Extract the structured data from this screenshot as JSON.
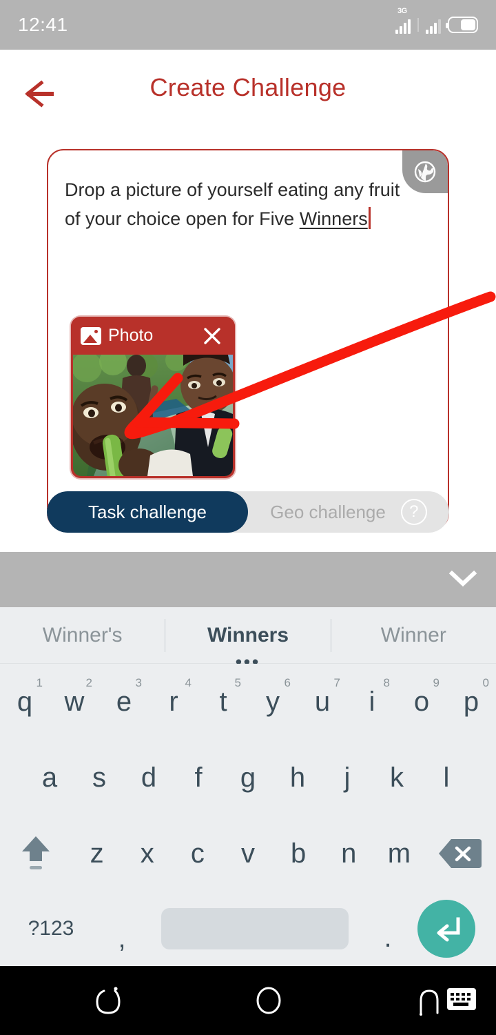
{
  "status_bar": {
    "time": "12:41",
    "network_label": "3G",
    "signal_icon": "signal-bars-icon",
    "battery_icon": "battery-icon",
    "battery_level_pct": 58,
    "background": "#b4b4b4"
  },
  "header": {
    "back_icon": "back-arrow-icon",
    "title": "Create Challenge",
    "title_color": "#b8312a"
  },
  "card": {
    "border_color": "#b8312a",
    "globe_icon": "globe-icon",
    "text_before": "Drop a picture of yourself eating any fruit of your choice open for Five ",
    "text_underlined": "Winners",
    "caret_color": "#b8312a",
    "attachment": {
      "icon": "image-icon",
      "label": "Photo",
      "close_icon": "close-icon",
      "header_color": "#b8312a"
    }
  },
  "segment_toggle": {
    "active_label": "Task challenge",
    "active_color": "#103a5d",
    "inactive_label": "Geo challenge",
    "inactive_color": "#e4e4e4",
    "help_icon": "help-question-icon",
    "help_label": "?"
  },
  "annotation": {
    "arrow_icon": "red-annotation-arrow",
    "color": "#f71b0d"
  },
  "keyboard": {
    "collapse_icon": "chevron-down-icon",
    "suggestions": [
      {
        "label": "Winner's",
        "selected": false
      },
      {
        "label": "Winners",
        "selected": true,
        "dots": "•••"
      },
      {
        "label": "Winner",
        "selected": false
      }
    ],
    "row1": [
      {
        "letter": "q",
        "num": "1"
      },
      {
        "letter": "w",
        "num": "2"
      },
      {
        "letter": "e",
        "num": "3"
      },
      {
        "letter": "r",
        "num": "4"
      },
      {
        "letter": "t",
        "num": "5"
      },
      {
        "letter": "y",
        "num": "6"
      },
      {
        "letter": "u",
        "num": "7"
      },
      {
        "letter": "i",
        "num": "8"
      },
      {
        "letter": "o",
        "num": "9"
      },
      {
        "letter": "p",
        "num": "0"
      }
    ],
    "row2": [
      "a",
      "s",
      "d",
      "f",
      "g",
      "h",
      "j",
      "k",
      "l"
    ],
    "row3": [
      "z",
      "x",
      "c",
      "v",
      "b",
      "n",
      "m"
    ],
    "shift_icon": "shift-key-icon",
    "backspace_icon": "backspace-key-icon",
    "symbols_label": "?123",
    "comma_label": ",",
    "period_label": ".",
    "space_label": "",
    "enter_icon": "enter-key-icon",
    "enter_color": "#43b3a5"
  },
  "navbar": {
    "recents_icon": "recents-icon",
    "home_icon": "home-icon",
    "back_icon": "nav-back-icon",
    "keyboard_icon": "keyboard-icon",
    "background": "#000000"
  }
}
